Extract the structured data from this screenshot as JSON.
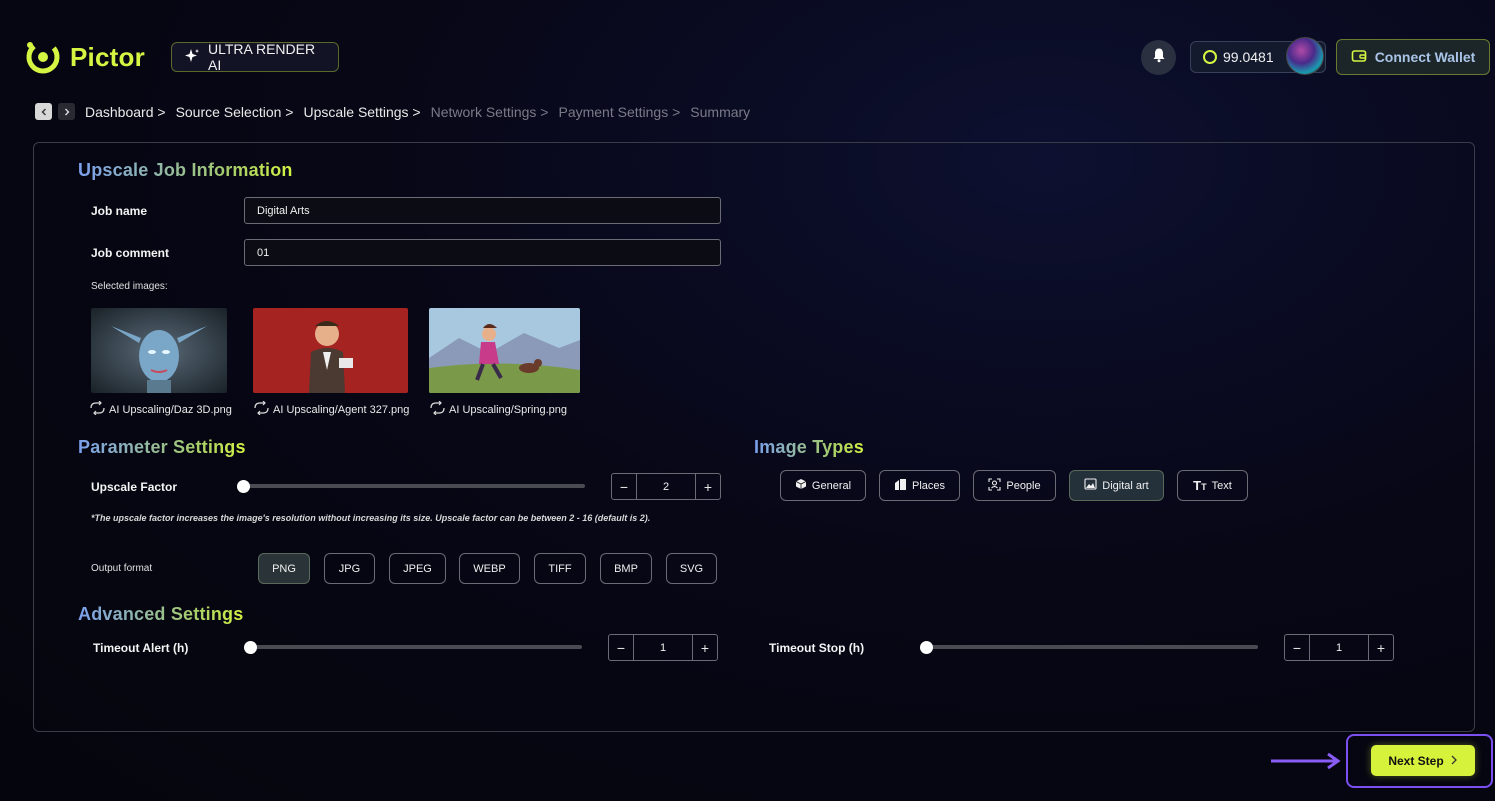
{
  "header": {
    "logo_text": "Pictor",
    "ultra_label": "ULTRA RENDER AI",
    "balance": "99.0481",
    "wallet_label": "Connect Wallet"
  },
  "breadcrumb": {
    "items": [
      "Dashboard >",
      "Source Selection >",
      "Upscale Settings >",
      "Network Settings >",
      "Payment Settings >",
      "Summary"
    ]
  },
  "job": {
    "section_title": "Upscale Job Information",
    "name_label": "Job name",
    "name_value": "Digital Arts",
    "comment_label": "Job comment",
    "comment_value": "01",
    "selected_label": "Selected images:",
    "images": [
      {
        "caption": "AI Upscaling/Daz 3D.png"
      },
      {
        "caption": "AI Upscaling/Agent 327.png"
      },
      {
        "caption": "AI Upscaling/Spring.png"
      }
    ]
  },
  "params": {
    "section_title": "Parameter Settings",
    "upscale_label": "Upscale Factor",
    "upscale_value": "2",
    "upscale_level": 0.0,
    "note": "*The upscale factor increases the image's resolution without increasing its size. Upscale factor can be between 2 - 16 (default is 2).",
    "output_label": "Output format",
    "formats": [
      "PNG",
      "JPG",
      "JPEG",
      "WEBP",
      "TIFF",
      "BMP",
      "SVG"
    ],
    "selected_format": "PNG"
  },
  "image_types": {
    "section_title": "Image Types",
    "types": [
      {
        "label": "General",
        "icon": "cube-icon"
      },
      {
        "label": "Places",
        "icon": "buildings-icon"
      },
      {
        "label": "People",
        "icon": "person-scan-icon"
      },
      {
        "label": "Digital art",
        "icon": "image-icon"
      },
      {
        "label": "Text",
        "icon": "text-size-icon"
      }
    ],
    "selected": "Digital art"
  },
  "advanced": {
    "section_title": "Advanced Settings",
    "timeout_alert_label": "Timeout Alert (h)",
    "timeout_alert_value": "1",
    "timeout_stop_label": "Timeout Stop (h)",
    "timeout_stop_value": "1"
  },
  "footer": {
    "next_label": "Next Step",
    "highlight_color": "#7b4ff0",
    "accent_color": "#d6f23a"
  }
}
